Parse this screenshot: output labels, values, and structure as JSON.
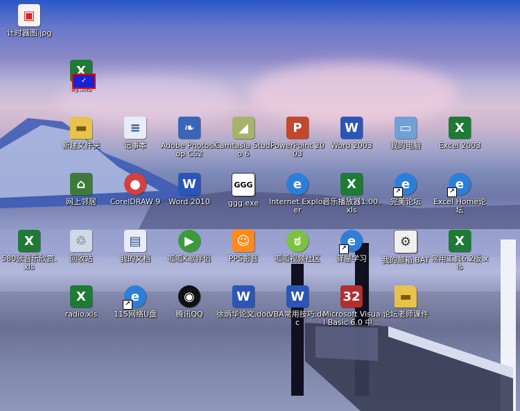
{
  "desktop": {
    "icons": [
      {
        "label": "计时器图.jpg",
        "icon": "image-icon"
      },
      {
        "label": "时.xls",
        "icon": "excel-file-icon"
      },
      {
        "label": "新建文件夹",
        "icon": "folder-icon"
      },
      {
        "label": "记事本",
        "icon": "notepad-icon"
      },
      {
        "label": "Adobe Photoshop CS2",
        "icon": "photoshop-icon"
      },
      {
        "label": "Camtasia Studio 6",
        "icon": "camtasia-icon"
      },
      {
        "label": "PowerPoint 2003",
        "icon": "powerpoint-icon"
      },
      {
        "label": "Word 2003",
        "icon": "word-icon"
      },
      {
        "label": "我的电脑",
        "icon": "my-computer-icon"
      },
      {
        "label": "Excel 2003",
        "icon": "excel-icon"
      },
      {
        "label": "网上邻居",
        "icon": "network-places-icon"
      },
      {
        "label": "CorelDRAW 9",
        "icon": "coreldraw-balloon-icon"
      },
      {
        "label": "Word 2010",
        "icon": "word-icon"
      },
      {
        "label": "ggg.exe",
        "icon": "ggg-exe-icon"
      },
      {
        "label": "Internet Explorer",
        "icon": "internet-explorer-icon"
      },
      {
        "label": "音乐播放器1.00.xls",
        "icon": "excel-file-icon"
      },
      {
        "label": "完美论坛",
        "icon": "ie-shortcut-icon"
      },
      {
        "label": "Excel Home论坛",
        "icon": "ie-shortcut-icon"
      },
      {
        "label": "580张音乐欣赏.xls",
        "icon": "excel-file-icon"
      },
      {
        "label": "回收站",
        "icon": "recycle-bin-icon"
      },
      {
        "label": "我的文档",
        "icon": "my-documents-icon"
      },
      {
        "label": "呱呱K歌伴侣",
        "icon": "media-player-icon"
      },
      {
        "label": "PPS影音",
        "icon": "pps-icon"
      },
      {
        "label": "呱呱视频社区",
        "icon": "frog-icon"
      },
      {
        "label": "驿屋学习",
        "icon": "ie-shortcut-icon"
      },
      {
        "label": "我的邮箱.BAT",
        "icon": "bat-file-icon"
      },
      {
        "label": "常用工具6.2版.xls",
        "icon": "excel-file-icon"
      },
      {
        "label": "radio.xls",
        "icon": "excel-file-icon"
      },
      {
        "label": "115网络U盘",
        "icon": "ie-shortcut-icon"
      },
      {
        "label": "腾讯QQ",
        "icon": "qq-penguin-icon"
      },
      {
        "label": "徐炳华论文.doc",
        "icon": "word-doc-icon"
      },
      {
        "label": "VBA常用技巧.doc",
        "icon": "word-doc-icon"
      },
      {
        "label": "Microsoft Visual Basic 6.0 中...",
        "icon": "visual-basic-icon"
      },
      {
        "label": "论坛老师课件",
        "icon": "folder-icon"
      }
    ]
  }
}
